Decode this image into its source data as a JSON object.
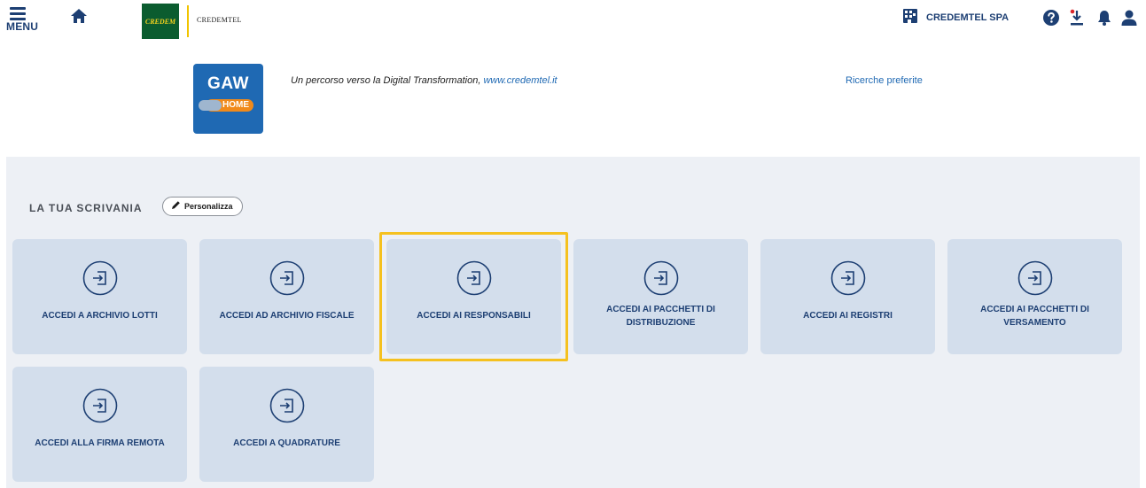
{
  "topbar": {
    "menu_label": "MENU",
    "brand_logo_text": "CREDEM",
    "brand_name": "CREDEMTEL",
    "company_name": "CREDEMTEL SPA",
    "icons": [
      "menu-icon",
      "home-icon",
      "building-icon",
      "help-icon",
      "download-icon",
      "bell-icon",
      "user-icon"
    ],
    "colors": {
      "accent": "#1d3f73",
      "notification_dot": "#d9262b"
    }
  },
  "header": {
    "app_logo_text": "GAW",
    "app_logo_sub": "HOME",
    "tagline_text": "Un percorso verso la Digital Transformation, ",
    "tagline_link": "www.credemtel.it",
    "favorites_link": "Ricerche preferite"
  },
  "desk": {
    "title": "LA TUA SCRIVANIA",
    "personalize_label": "Personalizza",
    "tiles": [
      {
        "label": "ACCEDI A ARCHIVIO LOTTI"
      },
      {
        "label": "ACCEDI AD ARCHIVIO FISCALE"
      },
      {
        "label": "ACCEDI AI RESPONSABILI",
        "highlighted": true
      },
      {
        "label": "ACCEDI AI PACCHETTI DI DISTRIBUZIONE"
      },
      {
        "label": "ACCEDI AI REGISTRI"
      },
      {
        "label": "ACCEDI AI PACCHETTI DI VERSAMENTO"
      },
      {
        "label": "ACCEDI ALLA FIRMA REMOTA"
      },
      {
        "label": "ACCEDI A QUADRATURE"
      }
    ],
    "colors": {
      "tile_bg": "#d3deec",
      "highlight": "#f5c11f",
      "desk_bg": "#edf0f5"
    }
  }
}
